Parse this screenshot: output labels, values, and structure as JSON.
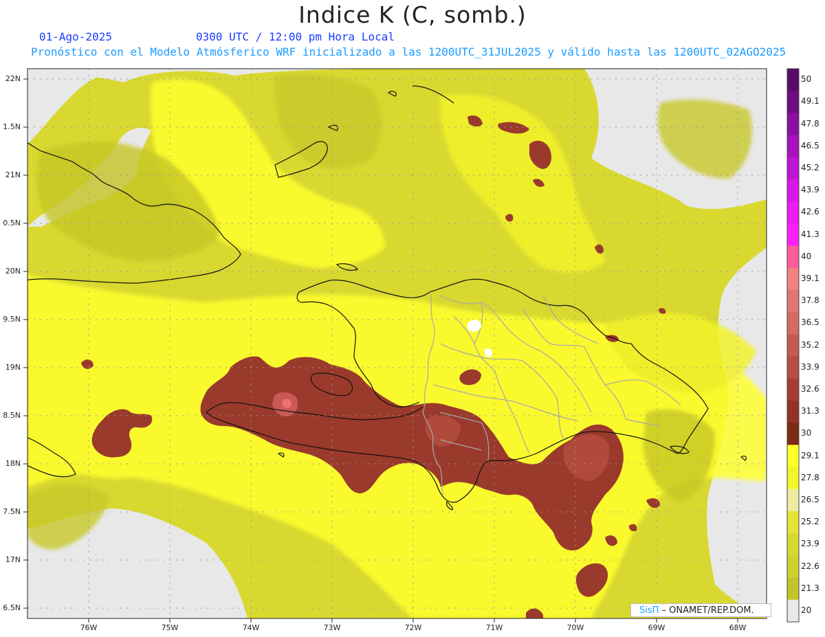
{
  "header": {
    "title": "Indice K (C, somb.)",
    "date": "01-Ago-2025",
    "time": "0300 UTC / 12:00 pm Hora Local",
    "description": "Pronóstico con el Modelo Atmósferico WRF inicializado a las 1200UTC_31JUL2025 y válido hasta las  1200UTC_02AGO2025"
  },
  "axes": {
    "lat_labels": [
      "22N",
      "1.5N",
      "21N",
      "0.5N",
      "20N",
      "9.5N",
      "19N",
      "8.5N",
      "18N",
      "7.5N",
      "17N",
      "6.5N"
    ],
    "lon_labels": [
      "76W",
      "75W",
      "74W",
      "73W",
      "72W",
      "71W",
      "70W",
      "69W",
      "68W"
    ]
  },
  "colorbar": {
    "labels": [
      "50",
      "49.1",
      "47.8",
      "46.5",
      "45.2",
      "43.9",
      "42.6",
      "41.3",
      "40",
      "39.1",
      "37.8",
      "36.5",
      "35.2",
      "33.9",
      "32.6",
      "31.3",
      "30",
      "29.1",
      "27.8",
      "26.5",
      "25.2",
      "23.9",
      "22.6",
      "21.3",
      "20"
    ],
    "colors": [
      "#5a0a6a",
      "#6f0c84",
      "#8a0ea0",
      "#a612bc",
      "#c014d4",
      "#d818e8",
      "#ec1cf4",
      "#ff20ff",
      "#ff5c9c",
      "#f28080",
      "#e27474",
      "#d46a62",
      "#c65a50",
      "#b64e42",
      "#a43e34",
      "#923226",
      "#7c2a14",
      "#ffff2a",
      "#f4f42a",
      "#ececa0",
      "#e4e436",
      "#d8d832",
      "#d0d02e",
      "#c4c42a",
      "#e8e8e8"
    ]
  },
  "credit": {
    "brand": "SisΠ",
    "text": " – ONAMET/REP.DOM."
  }
}
